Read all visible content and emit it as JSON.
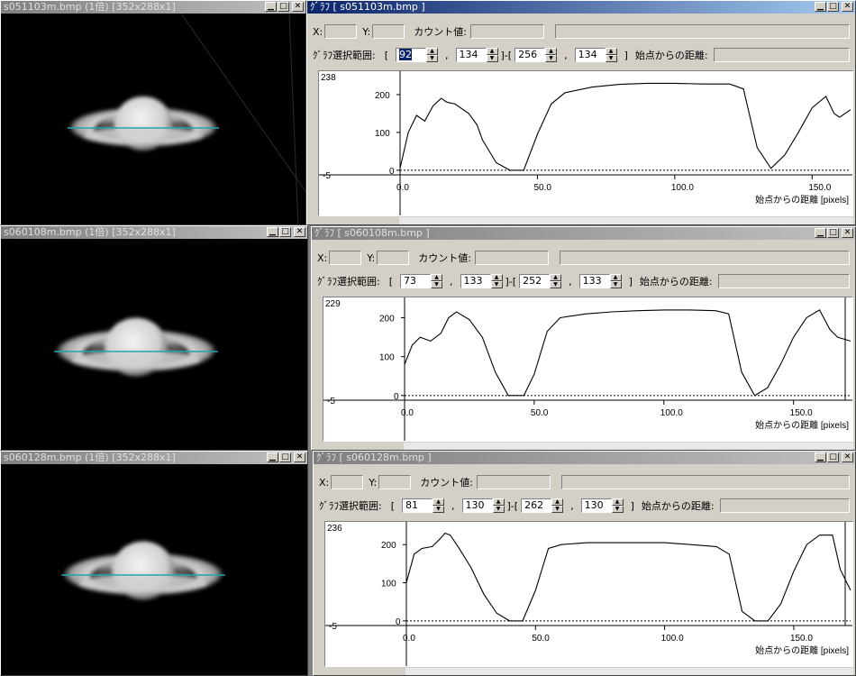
{
  "panels": [
    {
      "image_title": "s051103m.bmp (1倍) [352x288x1]",
      "graph_title": "ｸﾞﾗﾌ [ s051103m.bmp ]",
      "graph_active": true,
      "x_label": "X:",
      "y_label": "Y:",
      "count_label": "カウント値:",
      "range_label": "ｸﾞﾗﾌ選択範囲:",
      "bracket_open": "[",
      "bracket_mid": "]-[",
      "bracket_close": "]",
      "comma": ",",
      "distance_label": "始点からの距離:",
      "sel": {
        "x1": "92",
        "y1": "134",
        "x2": "256",
        "y2": "134"
      },
      "ymax_label": "238",
      "y_ticks": [
        "200",
        "100",
        "0",
        "-5"
      ],
      "x_ticks": [
        "0.0",
        "50.0",
        "100.0",
        "150.0"
      ],
      "xlabel": "始点からの距離 [pixels]"
    },
    {
      "image_title": "s060108m.bmp (1倍) [352x288x1]",
      "graph_title": "ｸﾞﾗﾌ [ s060108m.bmp ]",
      "graph_active": false,
      "x_label": "X:",
      "y_label": "Y:",
      "count_label": "カウント値:",
      "range_label": "ｸﾞﾗﾌ選択範囲:",
      "bracket_open": "[",
      "bracket_mid": "]-[",
      "bracket_close": "]",
      "comma": ",",
      "distance_label": "始点からの距離:",
      "sel": {
        "x1": "73",
        "y1": "133",
        "x2": "252",
        "y2": "133"
      },
      "ymax_label": "229",
      "y_ticks": [
        "200",
        "100",
        "0",
        "-5"
      ],
      "x_ticks": [
        "0.0",
        "50.0",
        "100.0",
        "150.0"
      ],
      "xlabel": "始点からの距離 [pixels]"
    },
    {
      "image_title": "s060128m.bmp (1倍) [352x288x1]",
      "graph_title": "ｸﾞﾗﾌ [ s060128m.bmp ]",
      "graph_active": false,
      "x_label": "X:",
      "y_label": "Y:",
      "count_label": "カウント値:",
      "range_label": "ｸﾞﾗﾌ選択範囲:",
      "bracket_open": "[",
      "bracket_mid": "]-[",
      "bracket_close": "]",
      "comma": ",",
      "distance_label": "始点からの距離:",
      "sel": {
        "x1": "81",
        "y1": "130",
        "x2": "262",
        "y2": "130"
      },
      "ymax_label": "236",
      "y_ticks": [
        "200",
        "100",
        "0",
        "-5"
      ],
      "x_ticks": [
        "0.0",
        "50.0",
        "100.0",
        "150.0"
      ],
      "xlabel": "始点からの距離 [pixels]"
    }
  ],
  "chart_data": [
    {
      "type": "line",
      "title": "",
      "xlabel": "始点からの距離 [pixels]",
      "ylabel": "",
      "xlim": [
        0,
        164
      ],
      "ylim": [
        -5,
        238
      ],
      "series": [
        {
          "x": [
            0,
            3,
            6,
            9,
            12,
            15,
            17,
            20,
            25,
            28,
            30,
            35,
            40,
            45,
            50,
            55,
            60,
            70,
            80,
            90,
            100,
            110,
            120,
            125,
            130,
            135,
            140,
            145,
            150,
            155,
            158,
            160,
            164
          ],
          "y": [
            5,
            100,
            145,
            130,
            170,
            190,
            180,
            175,
            150,
            120,
            80,
            20,
            0,
            0,
            95,
            175,
            205,
            220,
            227,
            230,
            230,
            228,
            228,
            215,
            60,
            5,
            40,
            100,
            165,
            195,
            150,
            140,
            160
          ]
        }
      ]
    },
    {
      "type": "line",
      "title": "",
      "xlabel": "始点からの距離 [pixels]",
      "ylabel": "",
      "xlim": [
        0,
        172
      ],
      "ylim": [
        -5,
        229
      ],
      "series": [
        {
          "x": [
            0,
            3,
            6,
            10,
            14,
            17,
            20,
            25,
            30,
            35,
            40,
            46,
            50,
            55,
            60,
            70,
            80,
            90,
            100,
            110,
            120,
            125,
            130,
            135,
            140,
            145,
            150,
            155,
            160,
            164,
            167,
            172
          ],
          "y": [
            80,
            130,
            150,
            140,
            160,
            200,
            215,
            195,
            150,
            60,
            0,
            0,
            55,
            165,
            200,
            210,
            215,
            218,
            220,
            220,
            218,
            210,
            60,
            0,
            20,
            80,
            150,
            200,
            220,
            170,
            150,
            140
          ]
        }
      ]
    },
    {
      "type": "line",
      "title": "",
      "xlabel": "始点からの距離 [pixels]",
      "ylabel": "",
      "xlim": [
        0,
        172
      ],
      "ylim": [
        -5,
        236
      ],
      "series": [
        {
          "x": [
            0,
            3,
            6,
            10,
            13,
            15,
            17,
            20,
            25,
            30,
            35,
            40,
            45,
            50,
            55,
            60,
            70,
            80,
            90,
            100,
            110,
            120,
            125,
            130,
            135,
            140,
            145,
            150,
            155,
            160,
            165,
            168,
            172
          ],
          "y": [
            100,
            175,
            190,
            195,
            215,
            230,
            225,
            195,
            140,
            70,
            20,
            0,
            0,
            80,
            190,
            200,
            205,
            205,
            205,
            205,
            200,
            195,
            175,
            25,
            0,
            0,
            45,
            130,
            200,
            225,
            225,
            135,
            80
          ]
        }
      ]
    }
  ]
}
